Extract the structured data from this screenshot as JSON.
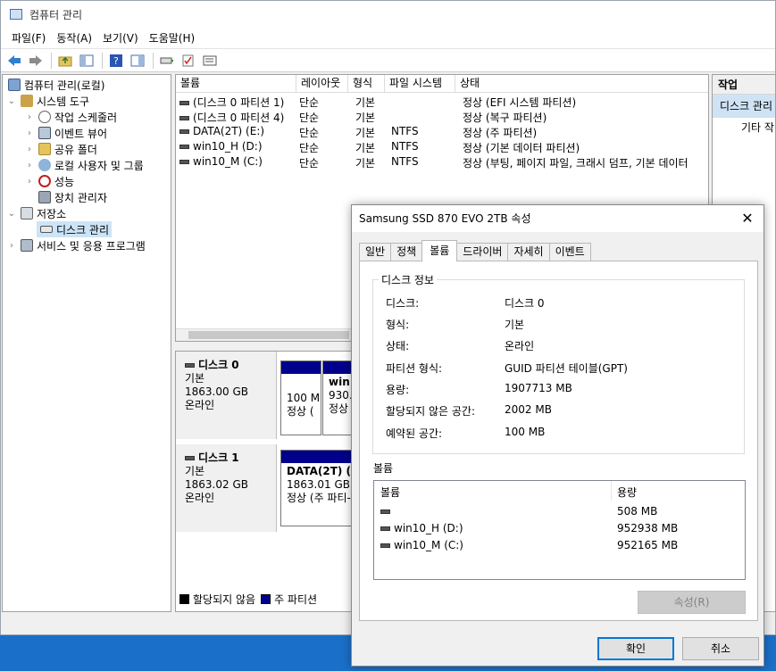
{
  "window": {
    "title": "컴퓨터 관리",
    "menu": [
      "파일(F)",
      "동작(A)",
      "보기(V)",
      "도움말(H)"
    ]
  },
  "tree": {
    "root": "컴퓨터 관리(로컬)",
    "system_tools": "시스템 도구",
    "task_scheduler": "작업 스케줄러",
    "event_viewer": "이벤트 뷰어",
    "shared_folders": "공유 폴더",
    "local_users": "로컬 사용자 및 그룹",
    "performance": "성능",
    "device_manager": "장치 관리자",
    "storage": "저장소",
    "disk_management": "디스크 관리",
    "services": "서비스 및 응용 프로그램"
  },
  "volume_list": {
    "headers": [
      "볼륨",
      "레이아웃",
      "형식",
      "파일 시스템",
      "상태"
    ],
    "rows": [
      {
        "volume": "(디스크 0 파티션 1)",
        "layout": "단순",
        "type": "기본",
        "fs": "",
        "status": "정상 (EFI 시스템 파티션)"
      },
      {
        "volume": "(디스크 0 파티션 4)",
        "layout": "단순",
        "type": "기본",
        "fs": "",
        "status": "정상 (복구 파티션)"
      },
      {
        "volume": "DATA(2T) (E:)",
        "layout": "단순",
        "type": "기본",
        "fs": "NTFS",
        "status": "정상 (주 파티션)"
      },
      {
        "volume": "win10_H (D:)",
        "layout": "단순",
        "type": "기본",
        "fs": "NTFS",
        "status": "정상 (기본 데이터 파티션)"
      },
      {
        "volume": "win10_M (C:)",
        "layout": "단순",
        "type": "기본",
        "fs": "NTFS",
        "status": "정상 (부팅, 페이지 파일, 크래시 덤프, 기본 데이터"
      }
    ]
  },
  "disks": [
    {
      "name": "디스크 0",
      "type": "기본",
      "size": "1863.00 GB",
      "state": "온라인",
      "parts": [
        {
          "title": "",
          "l1": "100 M",
          "l2": "정상 ("
        },
        {
          "title": "win1",
          "l1": "930.(",
          "l2": "정상"
        }
      ]
    },
    {
      "name": "디스크 1",
      "type": "기본",
      "size": "1863.02 GB",
      "state": "온라인",
      "parts": [
        {
          "title": "DATA(2T) (E",
          "l1": "1863.01 GB N",
          "l2": "정상 (주 파티-"
        }
      ]
    }
  ],
  "legend": {
    "unallocated": "할당되지 않음",
    "primary": "주 파티션"
  },
  "actions": {
    "header": "작업",
    "selected": "디스크 관리",
    "more": "기타 작"
  },
  "dialog": {
    "title": "Samsung SSD 870 EVO 2TB 속성",
    "tabs": [
      "일반",
      "정책",
      "볼륨",
      "드라이버",
      "자세히",
      "이벤트"
    ],
    "group_label": "디스크 정보",
    "info": [
      {
        "k": "디스크:",
        "v": "디스크 0"
      },
      {
        "k": "형식:",
        "v": "기본"
      },
      {
        "k": "상태:",
        "v": "온라인"
      },
      {
        "k": "파티션 형식:",
        "v": "GUID 파티션 테이블(GPT)"
      },
      {
        "k": "용량:",
        "v": "1907713 MB"
      },
      {
        "k": "할당되지 않은 공간:",
        "v": "2002 MB"
      },
      {
        "k": "예약된 공간:",
        "v": "100 MB"
      }
    ],
    "volumes_label": "볼륨",
    "list_headers": [
      "볼륨",
      "용량"
    ],
    "list_rows": [
      {
        "name": "",
        "cap": "508 MB"
      },
      {
        "name": "win10_H (D:)",
        "cap": "952938 MB"
      },
      {
        "name": "win10_M (C:)",
        "cap": "952165 MB"
      }
    ],
    "properties_btn": "속성(R)",
    "ok": "확인",
    "cancel": "취소"
  },
  "colors": {
    "primary_partition": "#01008a",
    "selection": "#cce4f7",
    "accent": "#0078d7"
  }
}
